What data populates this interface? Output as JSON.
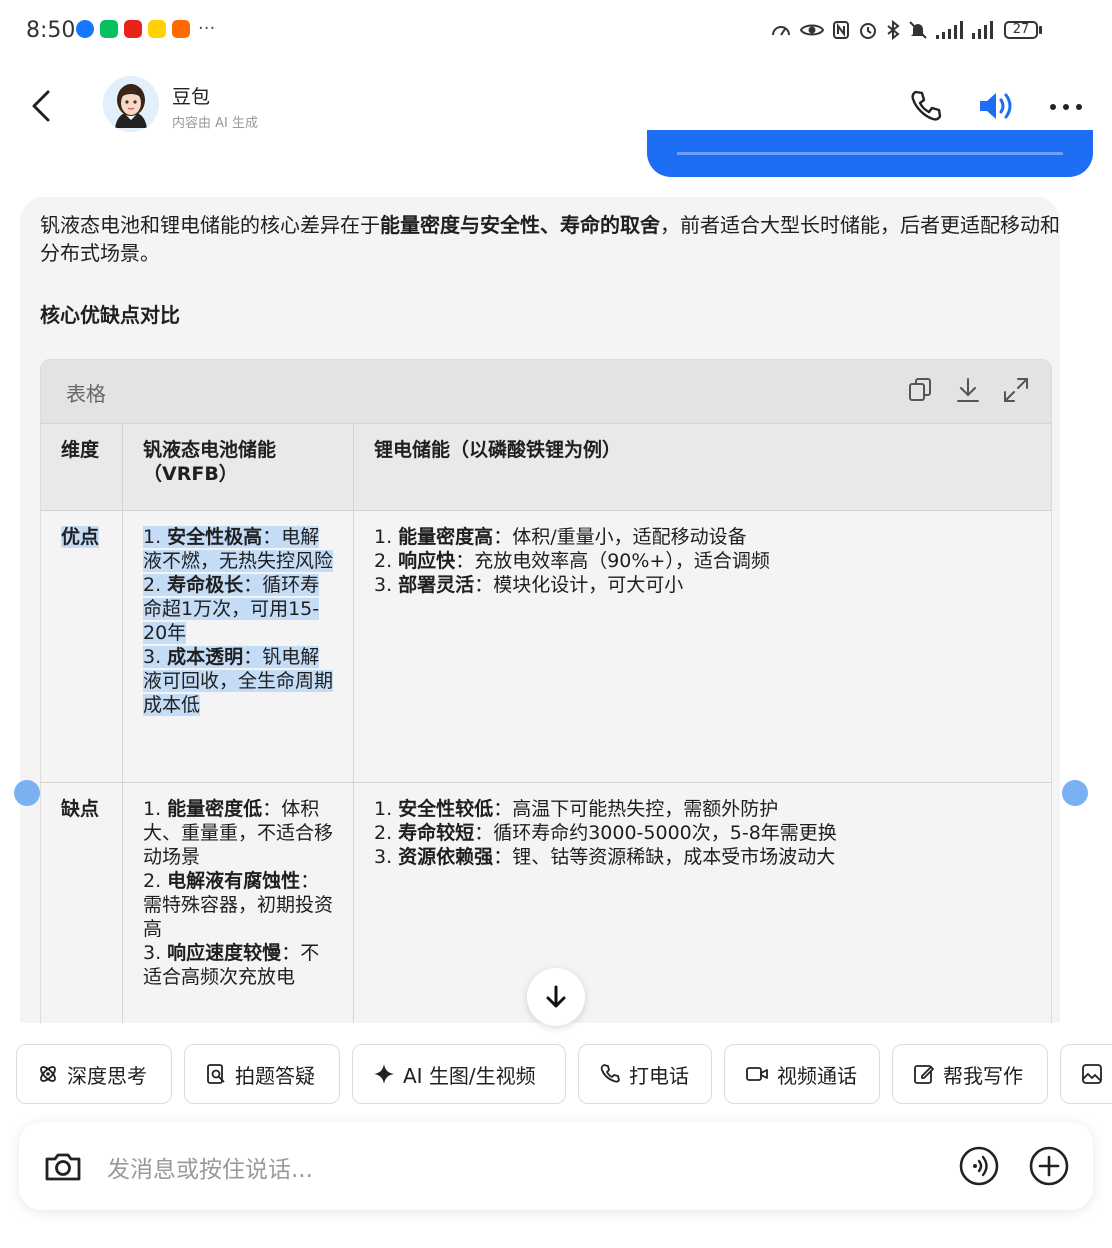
{
  "status": {
    "time": "8:50",
    "battery": "27",
    "app_colors": [
      "#1677ff",
      "#07c160",
      "#e8231a",
      "#ffd100",
      "#ff6a00"
    ]
  },
  "header": {
    "name": "豆包",
    "subtitle": "内容由 AI 生成"
  },
  "reply": {
    "intro_prefix": "钒液态电池和锂电储能的核心差异在于",
    "intro_bold": "能量密度与安全性、寿命的取舍",
    "intro_suffix": "，前者适合大型长时储能，后者更适配移动和分布式场景。",
    "section_title": "核心优缺点对比"
  },
  "table": {
    "label": "表格",
    "headers": [
      "维度",
      "钒液态电池储能（VRFB）",
      "锂电储能（以磷酸铁锂为例）"
    ],
    "rows": [
      {
        "dimension": "优点",
        "vrfb": [
          {
            "num": "1. ",
            "bold": "安全性极高",
            "text": "：电解液不燃，无热失控风险"
          },
          {
            "num": "2. ",
            "bold": "寿命极长",
            "text": "：循环寿命超1万次，可用15-20年"
          },
          {
            "num": "3. ",
            "bold": "成本透明",
            "text": "：钒电解液可回收，全生命周期成本低"
          }
        ],
        "lithium": [
          {
            "num": "1. ",
            "bold": "能量密度高",
            "text": "：体积/重量小，适配移动设备"
          },
          {
            "num": "2. ",
            "bold": "响应快",
            "text": "：充放电效率高（90%+），适合调频"
          },
          {
            "num": "3. ",
            "bold": "部署灵活",
            "text": "：模块化设计，可大可小"
          }
        ]
      },
      {
        "dimension": "缺点",
        "vrfb": [
          {
            "num": "1. ",
            "bold": "能量密度低",
            "text": "：体积大、重量重，不适合移动场景"
          },
          {
            "num": "2. ",
            "bold": "电解液有腐蚀性",
            "text": "：需特殊容器，初期投资高"
          },
          {
            "num": "3. ",
            "bold": "响应速度较慢",
            "text": "：不适合高频次充放电"
          }
        ],
        "lithium": [
          {
            "num": "1. ",
            "bold": "安全性较低",
            "text": "：高温下可能热失控，需额外防护"
          },
          {
            "num": "2. ",
            "bold": "寿命较短",
            "text": "：循环寿命约3000-5000次，5-8年需更换"
          },
          {
            "num": "3. ",
            "bold": "资源依赖强",
            "text": "：锂、钴等资源稀缺，成本受市场波动大"
          }
        ]
      }
    ]
  },
  "actions": [
    "深度思考",
    "拍题答疑",
    "AI 生图/生视频",
    "打电话",
    "视频通话",
    "帮我写作"
  ],
  "input": {
    "placeholder": "发消息或按住说话..."
  },
  "colors": {
    "accent": "#1e6ef5",
    "card_bg": "#f4f4f5",
    "selection": "#c5dcf7"
  }
}
